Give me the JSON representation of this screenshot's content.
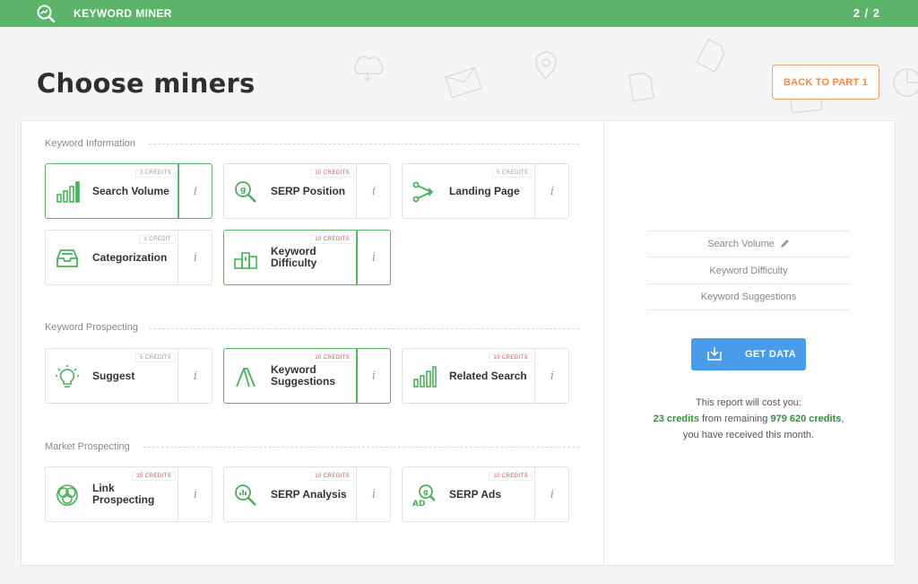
{
  "app": {
    "title": "KEYWORD MINER",
    "step": "2 / 2"
  },
  "page": {
    "title": "Choose miners",
    "back_label": "BACK TO PART 1"
  },
  "sections": [
    {
      "label": "Keyword Information"
    },
    {
      "label": "Keyword Prospecting"
    },
    {
      "label": "Market Prospecting"
    }
  ],
  "miners": [
    {
      "name": "Search Volume",
      "credits": "3 CREDITS",
      "selected": true,
      "icon": "bar-chart-icon"
    },
    {
      "name": "SERP Position",
      "credits": "10 CREDITS",
      "selected": false,
      "icon": "serp-magnifier-icon"
    },
    {
      "name": "Landing Page",
      "credits": "5 CREDITS",
      "selected": false,
      "icon": "branch-arrow-icon"
    },
    {
      "name": "Categorization",
      "credits": "1 CREDIT",
      "selected": false,
      "icon": "inbox-tray-icon"
    },
    {
      "name": "Keyword Difficulty",
      "credits": "10 CREDITS",
      "selected": true,
      "icon": "podium-icon"
    },
    {
      "name": "Suggest",
      "credits": "5 CREDITS",
      "selected": false,
      "icon": "lightbulb-icon"
    },
    {
      "name": "Keyword Suggestions",
      "credits": "10 CREDITS",
      "selected": true,
      "icon": "adwords-icon"
    },
    {
      "name": "Related Search",
      "credits": "10 CREDITS",
      "selected": false,
      "icon": "bar-chart-icon"
    },
    {
      "name": "Link Prospecting",
      "credits": "15 CREDITS",
      "selected": false,
      "icon": "linked-circles-icon"
    },
    {
      "name": "SERP Analysis",
      "credits": "10 CREDITS",
      "selected": false,
      "icon": "chart-magnifier-icon"
    },
    {
      "name": "SERP Ads",
      "credits": "10 CREDITS",
      "selected": false,
      "icon": "ad-magnifier-icon"
    }
  ],
  "info_label": "i",
  "summary": {
    "items": [
      "Search Volume",
      "Keyword Difficulty",
      "Keyword Suggestions"
    ],
    "get_data_label": "GET DATA",
    "cost_line1": "This report will cost you:",
    "cost_credits": "23 credits",
    "cost_mid": "from remaining",
    "remaining_credits": "979 620 credits",
    "cost_tail": ",",
    "cost_line3": "you have received this month."
  },
  "colors": {
    "brand_green": "#5cb36a",
    "accent_orange": "#ee8a4a",
    "button_blue": "#4a9be8",
    "credit_red": "#d9534f"
  }
}
